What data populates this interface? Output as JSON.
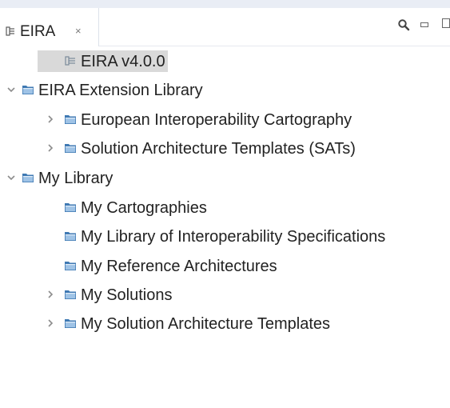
{
  "view": {
    "tab_title": "EIRA",
    "tab_close_glyph": "×",
    "toolbar": {
      "search_icon": "search-icon",
      "minimize_icon": "minimize-icon",
      "maximize_icon": "maximize-icon"
    }
  },
  "tree": [
    {
      "label": "EIRA v4.0.0",
      "icon": "model-icon",
      "chevron": "none",
      "selected": true
    },
    {
      "label": "EIRA Extension Library",
      "icon": "folder-icon",
      "chevron": "expanded",
      "selected": false
    },
    {
      "label": "European Interoperability Cartography",
      "icon": "folder-icon",
      "chevron": "collapsed",
      "selected": false
    },
    {
      "label": "Solution Architecture Templates (SATs)",
      "icon": "folder-icon",
      "chevron": "collapsed",
      "selected": false
    },
    {
      "label": "My Library",
      "icon": "folder-icon",
      "chevron": "expanded",
      "selected": false
    },
    {
      "label": "My Cartographies",
      "icon": "folder-icon",
      "chevron": "none",
      "selected": false
    },
    {
      "label": "My Library of Interoperability Specifications",
      "icon": "folder-icon",
      "chevron": "none",
      "selected": false
    },
    {
      "label": "My Reference Architectures",
      "icon": "folder-icon",
      "chevron": "none",
      "selected": false
    },
    {
      "label": "My Solutions",
      "icon": "folder-icon",
      "chevron": "collapsed",
      "selected": false
    },
    {
      "label": "My Solution Architecture Templates",
      "icon": "folder-icon",
      "chevron": "collapsed",
      "selected": false
    }
  ],
  "colors": {
    "selection": "#d9d9d9",
    "folder_fill": "#3f79b3",
    "folder_light": "#9fc3e6",
    "chevron": "#8c8c8c"
  }
}
